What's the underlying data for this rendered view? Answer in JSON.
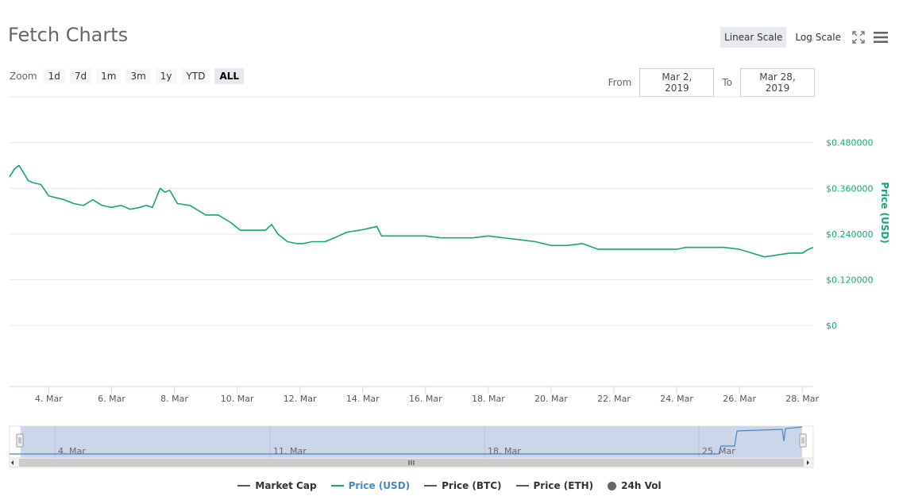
{
  "header": {
    "title": "Fetch Charts",
    "linear_scale": "Linear Scale",
    "log_scale": "Log Scale",
    "fullscreen_icon": "fullscreen-icon",
    "menu_icon": "hamburger-menu-icon"
  },
  "zoom": {
    "label": "Zoom",
    "buttons": [
      "1d",
      "7d",
      "1m",
      "3m",
      "1y",
      "YTD",
      "ALL"
    ],
    "active": "ALL"
  },
  "range": {
    "from_label": "From",
    "from_value": "Mar 2, 2019",
    "to_label": "To",
    "to_value": "Mar 28, 2019"
  },
  "navigator": {
    "labels": [
      "4. Mar",
      "11. Mar",
      "18. Mar",
      "25. Mar"
    ]
  },
  "legend": {
    "items": [
      {
        "label": "Market Cap",
        "symbol": "line",
        "color": "#555555"
      },
      {
        "label": "Price (USD)",
        "symbol": "line",
        "color": "#16a47c",
        "active": true,
        "label_color": "#4a86c8"
      },
      {
        "label": "Price (BTC)",
        "symbol": "line",
        "color": "#555555"
      },
      {
        "label": "Price (ETH)",
        "symbol": "line",
        "color": "#555555"
      },
      {
        "label": "24h Vol",
        "symbol": "dot",
        "color": "#666666"
      }
    ]
  },
  "chart_data": {
    "type": "line",
    "xlabel": "",
    "ylabel": "Price (USD)",
    "y_axis_position": "right",
    "ylim": [
      -0.16,
      0.6
    ],
    "y_ticks": [
      "$0.480000",
      "$0.360000",
      "$0.240000",
      "$0.120000",
      "$0"
    ],
    "y_tick_values": [
      0.48,
      0.36,
      0.24,
      0.12,
      0
    ],
    "x_ticks": [
      "4. Mar",
      "6. Mar",
      "8. Mar",
      "10. Mar",
      "12. Mar",
      "14. Mar",
      "16. Mar",
      "18. Mar",
      "20. Mar",
      "22. Mar",
      "24. Mar",
      "26. Mar",
      "28. Mar"
    ],
    "x_tick_values": [
      4,
      6,
      8,
      10,
      12,
      14,
      16,
      18,
      20,
      22,
      24,
      26,
      28
    ],
    "xlim": [
      2.75,
      28.35
    ],
    "grid": true,
    "series": [
      {
        "name": "Price (USD)",
        "color": "#16a47c",
        "x": [
          2.75,
          2.9,
          3.05,
          3.2,
          3.35,
          3.5,
          3.75,
          4.0,
          4.25,
          4.5,
          4.8,
          5.1,
          5.4,
          5.7,
          6.0,
          6.3,
          6.6,
          6.9,
          7.1,
          7.3,
          7.55,
          7.7,
          7.85,
          8.1,
          8.5,
          9.0,
          9.4,
          9.8,
          10.1,
          10.5,
          10.9,
          11.1,
          11.3,
          11.6,
          11.9,
          12.1,
          12.4,
          12.8,
          13.1,
          13.5,
          13.9,
          14.2,
          14.45,
          14.6,
          15.0,
          15.5,
          16.0,
          16.5,
          17.0,
          17.5,
          18.0,
          18.5,
          19.0,
          19.5,
          20.0,
          20.5,
          21.0,
          21.5,
          22.0,
          22.5,
          23.0,
          23.5,
          24.0,
          24.3,
          24.6,
          25.0,
          25.5,
          26.0,
          26.4,
          26.8,
          27.2,
          27.6,
          28.0,
          28.2,
          28.35
        ],
        "values": [
          0.39,
          0.41,
          0.42,
          0.4,
          0.38,
          0.375,
          0.37,
          0.34,
          0.335,
          0.33,
          0.32,
          0.315,
          0.33,
          0.315,
          0.31,
          0.315,
          0.305,
          0.31,
          0.315,
          0.31,
          0.36,
          0.35,
          0.355,
          0.32,
          0.315,
          0.29,
          0.29,
          0.27,
          0.25,
          0.25,
          0.25,
          0.265,
          0.24,
          0.22,
          0.215,
          0.215,
          0.22,
          0.22,
          0.23,
          0.245,
          0.25,
          0.255,
          0.26,
          0.235,
          0.235,
          0.235,
          0.235,
          0.23,
          0.23,
          0.23,
          0.235,
          0.23,
          0.225,
          0.22,
          0.21,
          0.21,
          0.215,
          0.2,
          0.2,
          0.2,
          0.2,
          0.2,
          0.2,
          0.205,
          0.205,
          0.205,
          0.205,
          0.2,
          0.19,
          0.18,
          0.185,
          0.19,
          0.19,
          0.2,
          0.205
        ]
      }
    ]
  }
}
